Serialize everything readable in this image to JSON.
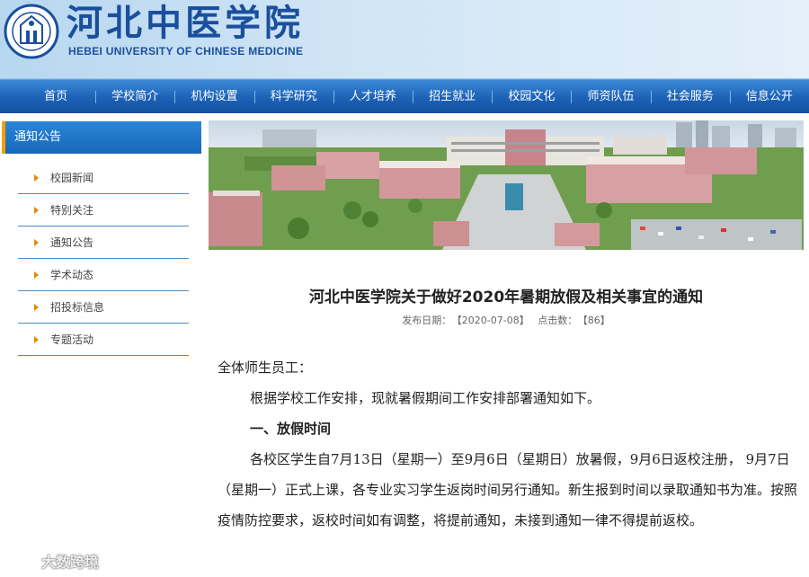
{
  "header": {
    "title_cn": "河北中医学院",
    "title_en": "HEBEI UNIVERSITY OF CHINESE MEDICINE"
  },
  "nav": [
    "首页",
    "学校简介",
    "机构设置",
    "科学研究",
    "人才培养",
    "招生就业",
    "校园文化",
    "师资队伍",
    "社会服务",
    "信息公开"
  ],
  "sidebar": {
    "heading": "通知公告",
    "items": [
      "校园新闻",
      "特别关注",
      "通知公告",
      "学术动态",
      "招投标信息",
      "专题活动"
    ]
  },
  "article": {
    "title": "河北中医学院关于做好2020年暑期放假及相关事宜的通知",
    "date_label": "发布日期：",
    "date_value": "【2020-07-08】",
    "clicks_label": "点击数：",
    "clicks_value": "【86】",
    "greeting": "全体师生员工：",
    "intro": "根据学校工作安排，现就暑假期间工作安排部署通知如下。",
    "section1": "一、放假时间",
    "para1": "各校区学生自7月13日（星期一）至9月6日（星期日）放暑假，9月6日返校注册， 9月7日（星期一）正式上课，各专业实习学生返岗时间另行通知。新生报到时间以录取通知书为准。按照疫情防控要求，返校时间如有调整，将提前通知，未接到通知一律不得提前返校。"
  },
  "watermark": {
    "text": "大数跨境"
  },
  "colors": {
    "nav_blue": "#1c61b6",
    "sidebar_accent": "#f5a000",
    "logo_blue": "#1a4f9c"
  }
}
